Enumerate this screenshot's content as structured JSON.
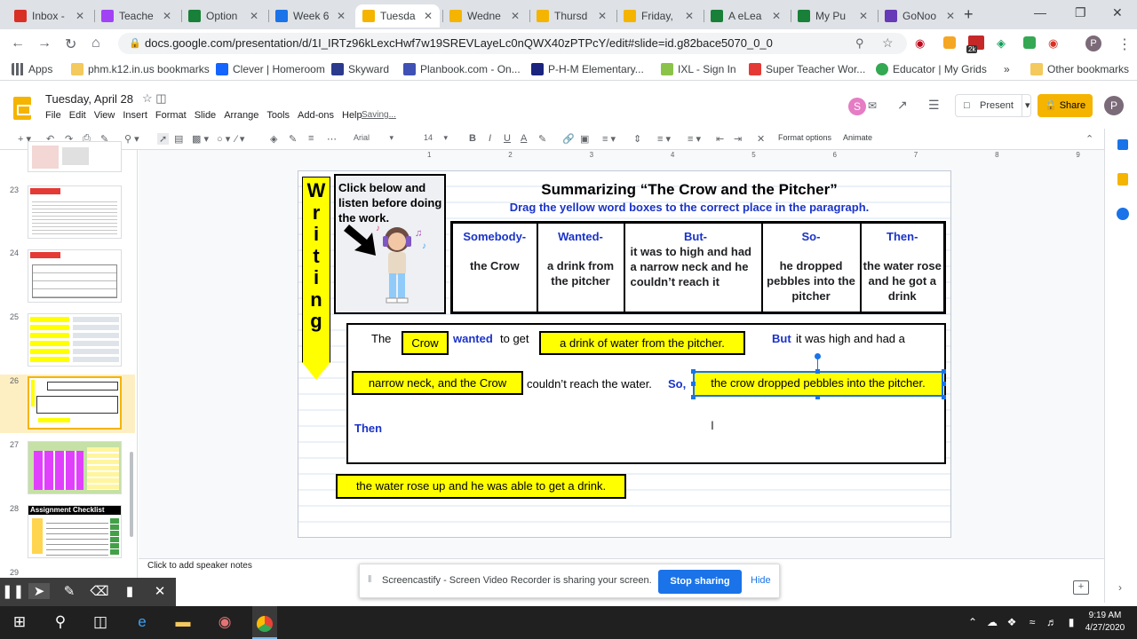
{
  "tabs": [
    {
      "title": "Inbox -",
      "color": "#d93025",
      "active": false
    },
    {
      "title": "Teache",
      "color": "#a142f4",
      "active": false
    },
    {
      "title": "Option",
      "color": "#188038",
      "active": false
    },
    {
      "title": "Week 6",
      "color": "#1a73e8",
      "active": false
    },
    {
      "title": "Tuesda",
      "color": "#f4b400",
      "active": true
    },
    {
      "title": "Wedne",
      "color": "#f4b400",
      "active": false
    },
    {
      "title": "Thursd",
      "color": "#f4b400",
      "active": false
    },
    {
      "title": "Friday,",
      "color": "#f4b400",
      "active": false
    },
    {
      "title": "A eLea",
      "color": "#188038",
      "active": false
    },
    {
      "title": "My Pu",
      "color": "#188038",
      "active": false
    },
    {
      "title": "GoNoo",
      "color": "#673ab7",
      "active": false
    }
  ],
  "url": "docs.google.com/presentation/d/1I_IRTz96kLexcHwf7w19SREVLayeLc0nQWX40zPTPcY/edit#slide=id.g82bace5070_0_0",
  "bookmarks": [
    "Apps",
    "phm.k12.in.us bookmarks",
    "Clever | Homeroom",
    "Skyward",
    "Planbook.com - On...",
    "P-H-M Elementary...",
    "IXL - Sign In",
    "Super Teacher Wor...",
    "Educator | My Grids",
    "Other bookmarks"
  ],
  "bookmark_extension_badge": "2k",
  "doc": {
    "title": "Tuesday, April 28",
    "menus": [
      "File",
      "Edit",
      "View",
      "Insert",
      "Format",
      "Slide",
      "Arrange",
      "Tools",
      "Add-ons",
      "Help"
    ],
    "status": "Saving...",
    "collaborator": "S",
    "present_label": "Present",
    "share_label": "Share",
    "user_initial": "P"
  },
  "toolbar": {
    "font": "Arial",
    "size": "14",
    "format_options": "Format options",
    "animate": "Animate"
  },
  "ruler_marks": [
    "1",
    "2",
    "3",
    "4",
    "5",
    "6",
    "7",
    "8",
    "9"
  ],
  "filmstrip": {
    "slide_numbers": [
      "23",
      "24",
      "25",
      "26",
      "27",
      "28",
      "29"
    ],
    "selected": "26",
    "checklist_title": "Assignment Checklist"
  },
  "slide": {
    "writing_label": "Writing",
    "instructions": "Click below and listen before doing the work.",
    "title": "Summarizing “The Crow and the Pitcher”",
    "subtitle": "Drag the yellow word boxes to the correct place in the paragraph.",
    "table": [
      {
        "header": "Somebody-",
        "body": "the Crow"
      },
      {
        "header": "Wanted-",
        "body": "a drink from the pitcher"
      },
      {
        "header": "But-",
        "body": "it was to high and had a narrow neck and he couldn’t reach it"
      },
      {
        "header": "So-",
        "body": "he dropped pebbles into the pitcher"
      },
      {
        "header": "Then-",
        "body": "the water rose and he got a drink"
      }
    ],
    "paragraph": {
      "the": "The",
      "box_crow": "Crow",
      "wanted": "wanted",
      "to_get": "to get",
      "box_drink": "a drink of water from the pitcher.",
      "but": "But",
      "but_rest": "it was high and had a",
      "box_neck": "narrow neck, and the Crow",
      "couldnt": "couldn’t reach the water.",
      "so": "So,",
      "box_pebbles": "the crow dropped pebbles into the pitcher.",
      "then": "Then"
    },
    "loose_box": "the water rose up and he was able to get a drink."
  },
  "speaker_notes_placeholder": "Click to add speaker notes",
  "screencastify": {
    "message": "Screencastify - Screen Video Recorder is sharing your screen.",
    "stop": "Stop sharing",
    "hide": "Hide"
  },
  "taskbar": {
    "time": "9:19 AM",
    "date": "4/27/2020"
  }
}
